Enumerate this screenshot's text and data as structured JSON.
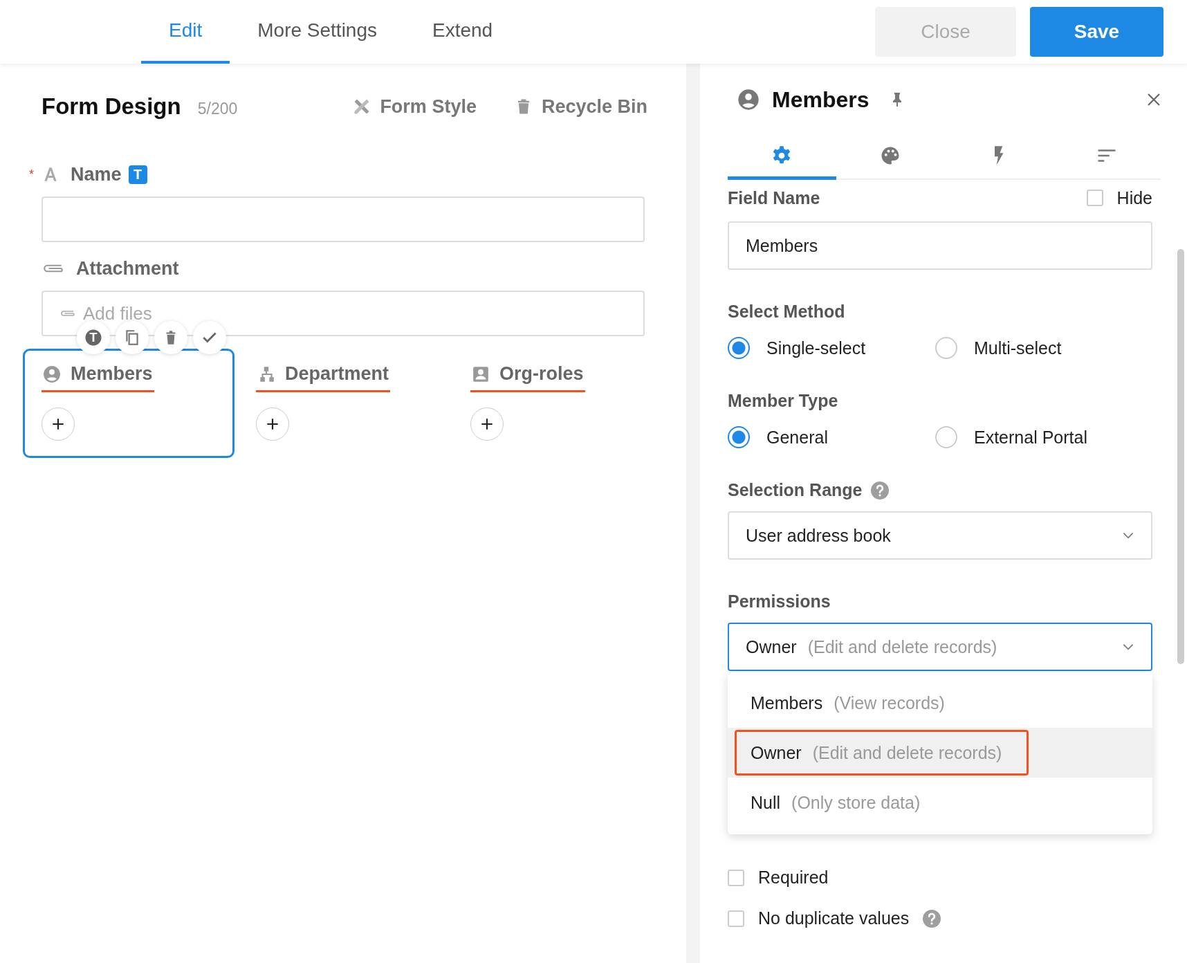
{
  "top_tabs": [
    {
      "label": "Edit",
      "selected": true
    },
    {
      "label": "More Settings",
      "selected": false
    },
    {
      "label": "Extend",
      "selected": false
    }
  ],
  "buttons": [
    {
      "label": "Close",
      "kind": "secondary"
    },
    {
      "label": "Save",
      "kind": "primary"
    }
  ],
  "form": {
    "title": "Form Design",
    "count": "5/200",
    "tools": [
      {
        "kind": "style",
        "label": "Form Style"
      },
      {
        "kind": "bin",
        "label": "Recycle Bin"
      }
    ],
    "fields": [
      {
        "kind": "text",
        "label": "Name",
        "required_mark": "*",
        "badge": "T"
      },
      {
        "kind": "attachment",
        "label": "Attachment",
        "placeholder": "Add files"
      }
    ],
    "member_fields": [
      {
        "kind": "member",
        "label": "Members",
        "selected": true
      },
      {
        "kind": "department",
        "label": "Department",
        "selected": false
      },
      {
        "kind": "role",
        "label": "Org-roles",
        "selected": false
      }
    ],
    "card_toolbar": {
      "badge": "T"
    }
  },
  "panel": {
    "title": "Members",
    "icon_tabs": [
      {
        "kind": "settings",
        "selected": true
      },
      {
        "kind": "palette",
        "selected": false
      },
      {
        "kind": "bolt",
        "selected": false
      },
      {
        "kind": "sort",
        "selected": false
      }
    ],
    "field_name": {
      "label": "Field Name",
      "hide": {
        "label": "Hide",
        "checked": false
      },
      "value": "Members"
    },
    "select_method": {
      "label": "Select Method",
      "options": [
        {
          "label": "Single-select",
          "selected": true
        },
        {
          "label": "Multi-select",
          "selected": false
        }
      ]
    },
    "member_type": {
      "label": "Member Type",
      "options": [
        {
          "label": "General",
          "selected": true
        },
        {
          "label": "External Portal",
          "selected": false
        }
      ]
    },
    "selection_range": {
      "label": "Selection Range",
      "help": true,
      "value": "User address book"
    },
    "permissions": {
      "label": "Permissions",
      "value": "Owner",
      "note": "(Edit and delete records)",
      "expanded": true,
      "options": [
        {
          "label": "Members",
          "note": "(View records)",
          "selected": false,
          "outlined": false
        },
        {
          "label": "Owner",
          "note": "(Edit and delete records)",
          "selected": true,
          "outlined": true
        },
        {
          "label": "Null",
          "note": "(Only store data)",
          "selected": false,
          "outlined": false
        }
      ]
    },
    "validation": {
      "checks": [
        {
          "label": "Required",
          "checked": false,
          "help": false
        },
        {
          "label": "No duplicate values",
          "checked": false,
          "help": true
        }
      ]
    }
  }
}
